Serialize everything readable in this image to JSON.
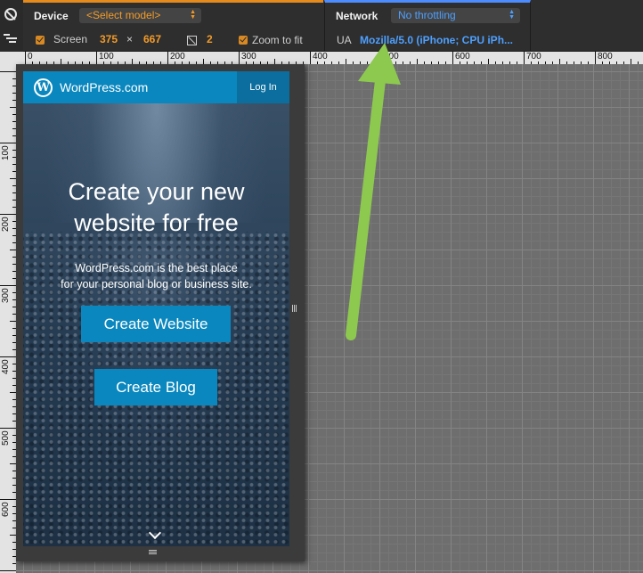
{
  "toolbar": {
    "device_label": "Device",
    "device_model": "<Select model>",
    "screen_label": "Screen",
    "screen_width": "375",
    "times": "×",
    "screen_height": "667",
    "dpr": "2",
    "zoom_label": "Zoom to fit",
    "network_label": "Network",
    "network_value": "No throttling",
    "ua_label": "UA",
    "ua_value": "Mozilla/5.0 (iPhone; CPU iPh..."
  },
  "ruler_top": [
    "0",
    "100",
    "200",
    "300",
    "400",
    "500",
    "600",
    "700",
    "800"
  ],
  "ruler_left": [
    "100",
    "200",
    "300",
    "400",
    "500",
    "600"
  ],
  "page": {
    "brand": "WordPress.com",
    "login": "Log In",
    "title_line1": "Create your new",
    "title_line2": "website for free",
    "subtitle_line1": "WordPress.com is the best place",
    "subtitle_line2": "for your personal blog or business site.",
    "create_website": "Create Website",
    "create_blog": "Create Blog"
  },
  "colors": {
    "toolbar_bg": "#2e2e2e",
    "device_accent": "#e58a1d",
    "network_accent": "#4c8cff",
    "wp_blue": "#0a87be",
    "arrow_green": "#8dc94f"
  },
  "icons": {
    "device_mode_toggle": "no-entry-icon",
    "menu": "menu-icon",
    "logo": "wordpress-logo-icon",
    "scroll": "chevron-down-icon"
  }
}
